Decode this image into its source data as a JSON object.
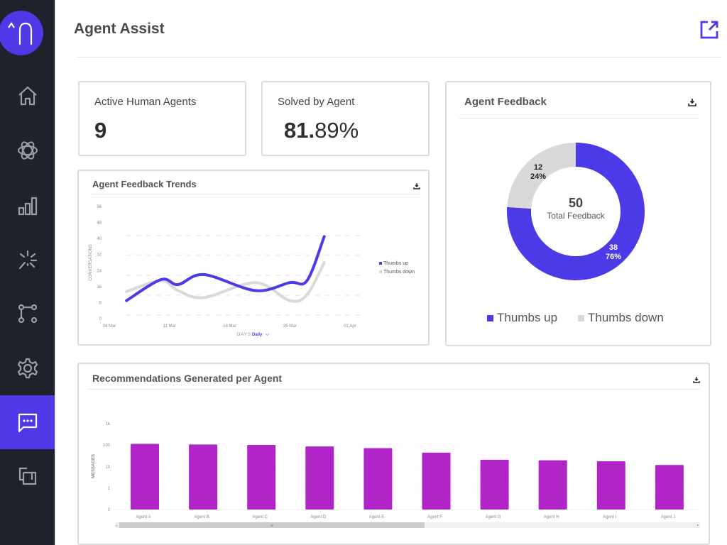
{
  "sidebar": {
    "logo_label": "^∩",
    "items": [
      {
        "name": "home",
        "icon": "home-icon",
        "active": false
      },
      {
        "name": "ai",
        "icon": "atom-icon",
        "active": false
      },
      {
        "name": "analytics",
        "icon": "bar-chart-icon",
        "active": false
      },
      {
        "name": "insights",
        "icon": "sparkle-icon",
        "active": false
      },
      {
        "name": "flows",
        "icon": "flow-icon",
        "active": false
      },
      {
        "name": "settings",
        "icon": "gear-icon",
        "active": false
      },
      {
        "name": "agent-assist",
        "icon": "chat-icon",
        "active": true
      },
      {
        "name": "integrations",
        "icon": "copy-icon",
        "active": false
      }
    ]
  },
  "header": {
    "title": "Agent Assist",
    "open_icon": "external-link-icon"
  },
  "colors": {
    "accent": "#5038e6",
    "sidebar_bg": "#1f212b",
    "thumbs_up": "#4b3ae6",
    "thumbs_down": "#d9d9d9",
    "bar": "#b124c8"
  },
  "kpis": {
    "active_agents": {
      "label": "Active Human Agents",
      "value": "9"
    },
    "solved": {
      "label": "Solved by Agent",
      "value_int": "81.",
      "value_dec": "89%"
    }
  },
  "trends": {
    "title": "Agent Feedback Trends",
    "filter_label": "DAYS",
    "filter_value": "Daily"
  },
  "feedback": {
    "title": "Agent Feedback",
    "total": "50",
    "total_label": "Total Feedback",
    "up_count": "38",
    "up_pct": "76%",
    "down_count": "12",
    "down_pct": "24%",
    "legend_up": "Thumbs up",
    "legend_down": "Thumbs down"
  },
  "recs": {
    "title": "Recommendations Generated per Agent",
    "scroll_label": "III"
  },
  "chart_data": [
    {
      "type": "line",
      "title": "Agent Feedback Trends",
      "xlabel": "DAYS",
      "ylabel": "CONVERSATIONS",
      "ylim": [
        0,
        56
      ],
      "yticks": [
        0,
        8,
        16,
        24,
        32,
        40,
        48,
        56
      ],
      "xticks": [
        "04 Mar",
        "11 Mar",
        "18 Mar",
        "25 Mar",
        "01 Apr"
      ],
      "x": [
        "06 Mar",
        "10 Mar",
        "12 Mar",
        "15 Mar",
        "21 Mar",
        "25 Mar",
        "27 Mar",
        "01 Apr"
      ],
      "series": [
        {
          "name": "Thumbs up",
          "values": [
            9,
            19.5,
            17,
            22,
            14,
            18,
            19,
            41
          ]
        },
        {
          "name": "Thumbs down",
          "values": [
            13.5,
            19,
            14,
            10.5,
            18,
            9,
            12,
            28
          ]
        }
      ],
      "legend": "right"
    },
    {
      "type": "pie",
      "title": "Agent Feedback",
      "labels": [
        "Thumbs up",
        "Thumbs down"
      ],
      "values": [
        38,
        12
      ],
      "percents": [
        76,
        24
      ],
      "center_value": 50,
      "center_label": "Total Feedback",
      "legend": "bottom"
    },
    {
      "type": "bar",
      "title": "Recommendations Generated per Agent",
      "ylabel": "MESSAGES",
      "yscale": "log",
      "yticks": [
        "0",
        "1",
        "10",
        "100",
        "1k"
      ],
      "categories": [
        "Agent A",
        "Agent B",
        "Agent C",
        "Agent D",
        "Agent E",
        "Agent F",
        "Agent G",
        "Agent H",
        "Agent I",
        "Agent J"
      ],
      "values": [
        115,
        108,
        103,
        88,
        73,
        45,
        21,
        20,
        18,
        12
      ]
    }
  ]
}
